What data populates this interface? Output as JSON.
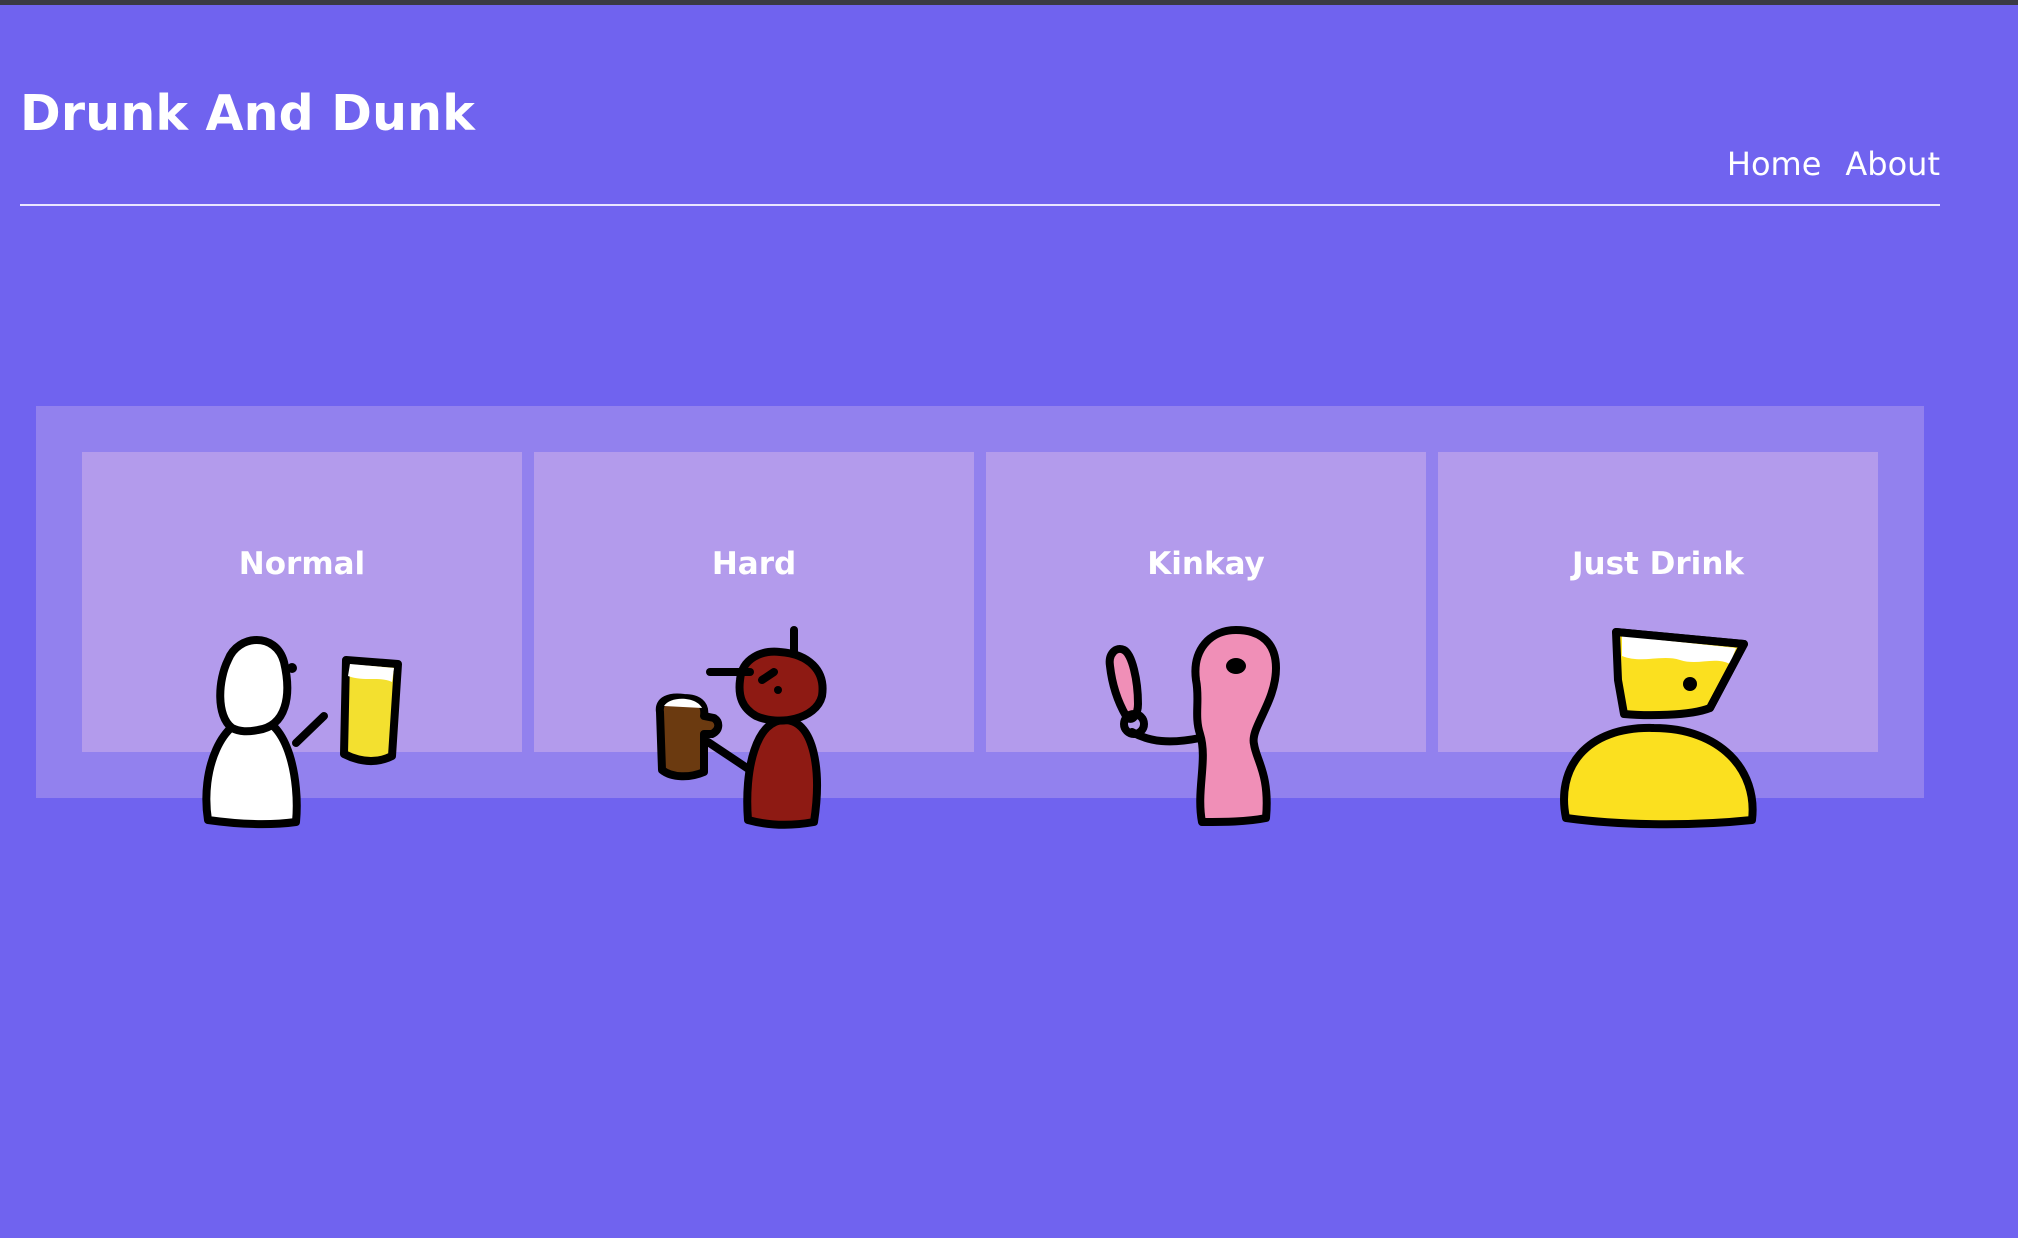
{
  "header": {
    "title": "Drunk And Dunk",
    "nav": [
      {
        "label": "Home"
      },
      {
        "label": "About"
      }
    ]
  },
  "modes": [
    {
      "label": "Normal",
      "icon": "white-blob-with-beer-icon",
      "color": "#ffffff",
      "drink_color": "#f3e02f"
    },
    {
      "label": "Hard",
      "icon": "red-blob-with-mug-icon",
      "color": "#8e1a13",
      "drink_color": "#6b3a10"
    },
    {
      "label": "Kinkay",
      "icon": "pink-blob-with-paddle-icon",
      "color": "#f08fb7"
    },
    {
      "label": "Just Drink",
      "icon": "yellow-blob-with-glass-icon",
      "color": "#fbe01f"
    }
  ],
  "colors": {
    "background": "#7063ef",
    "panel": "#9281ee",
    "card": "#b39bec"
  }
}
